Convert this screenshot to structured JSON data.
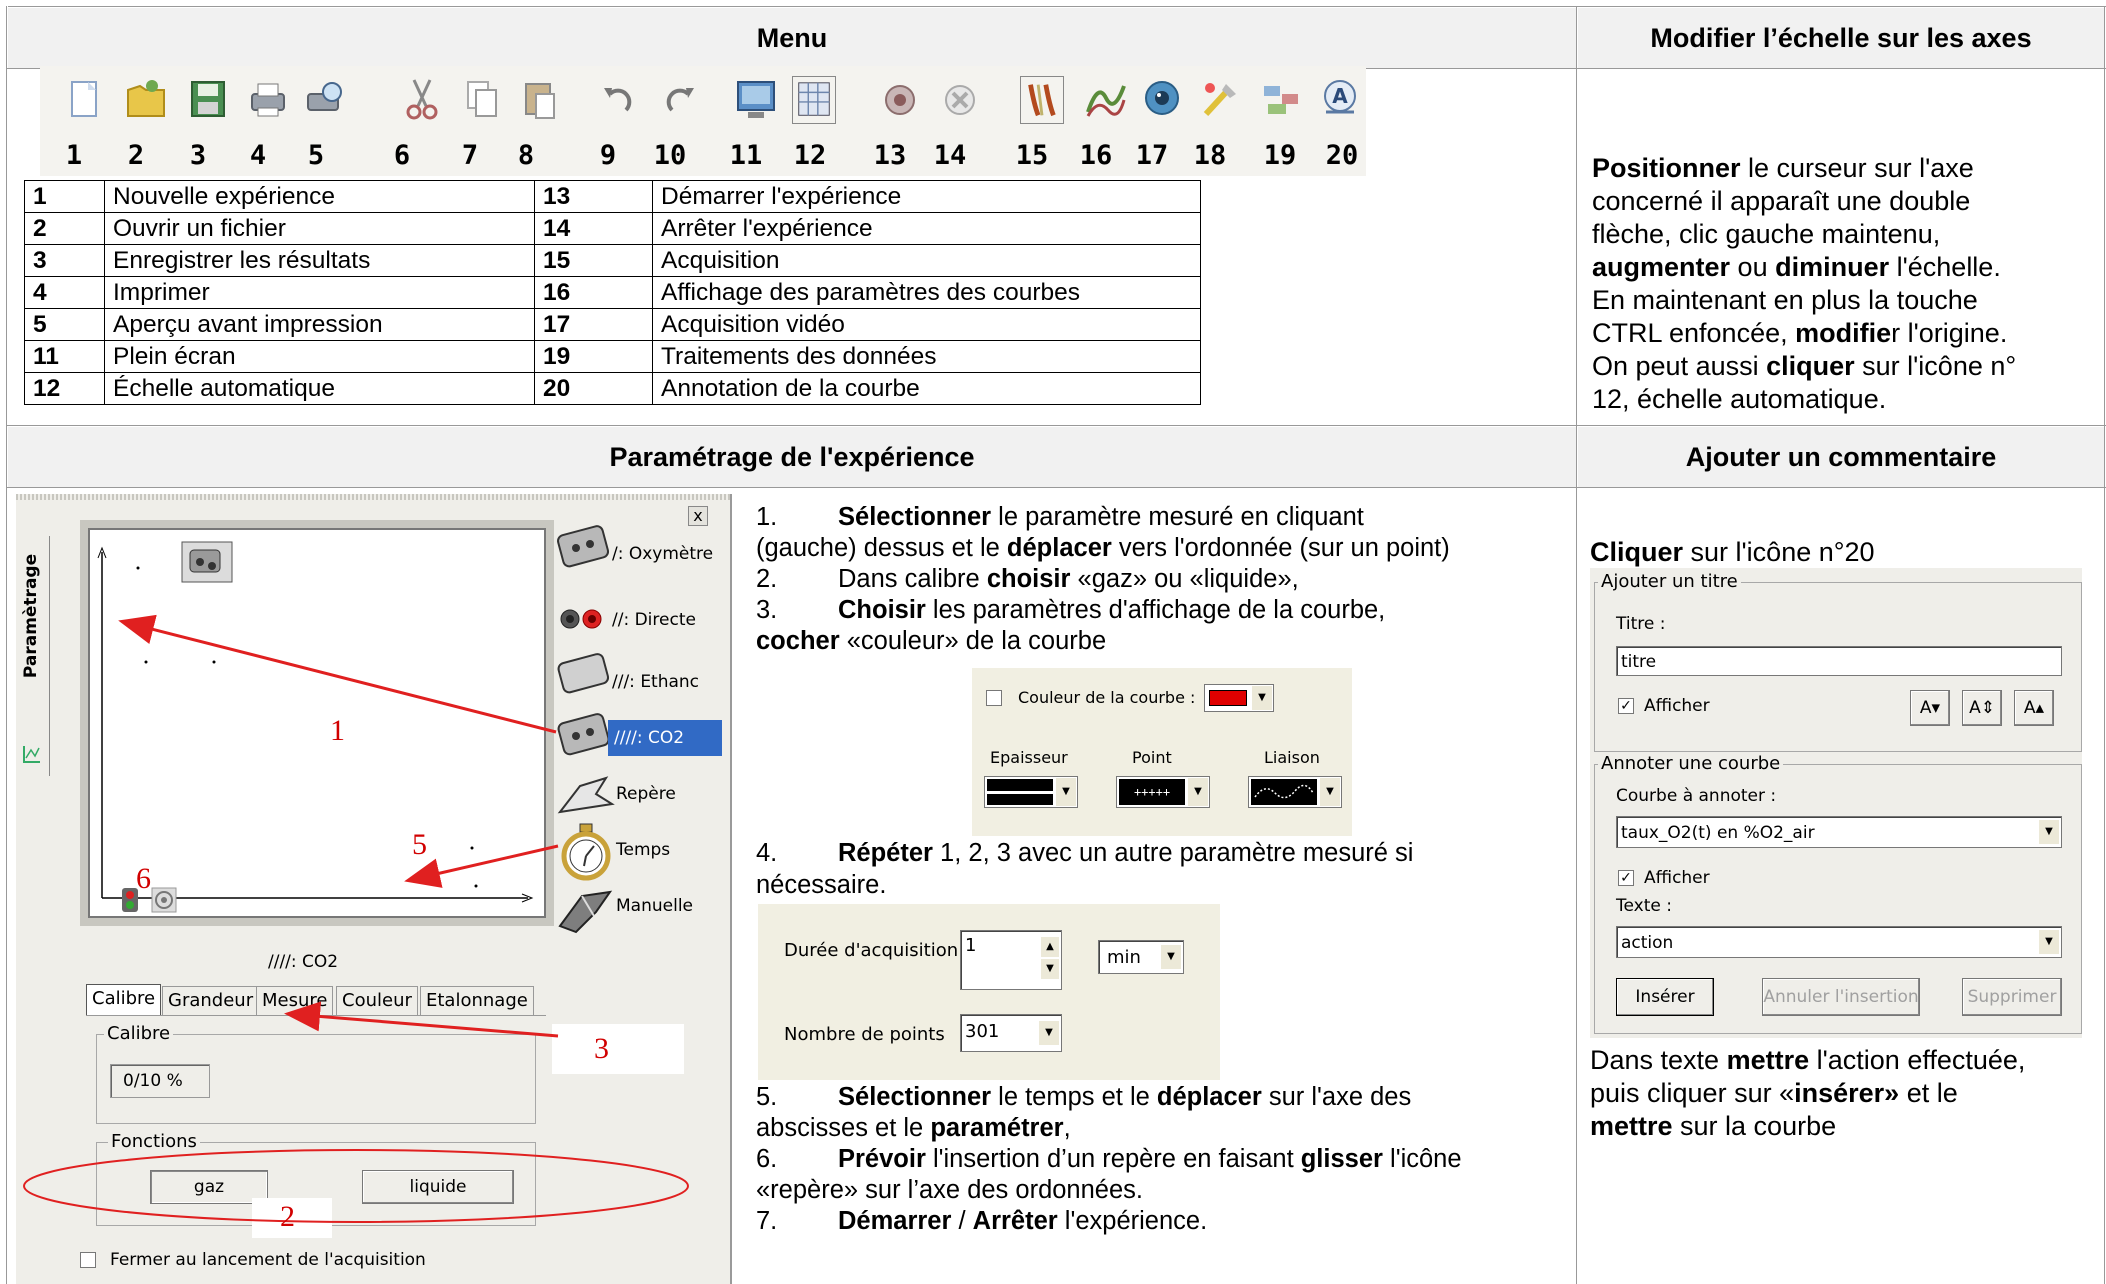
{
  "headers": {
    "menu": "Menu",
    "scale": "Modifier l’échelle sur les axes",
    "setup": "Paramétrage de l'expérience",
    "comment": "Ajouter un commentaire"
  },
  "toolbar": {
    "numbers": [
      "1",
      "2",
      "3",
      "4",
      "5",
      "6",
      "7",
      "8",
      "9",
      "10",
      "11",
      "12",
      "13",
      "14",
      "15",
      "16",
      "17",
      "18",
      "19",
      "20"
    ],
    "icons": [
      "new-file-icon",
      "open-folder-icon",
      "save-icon",
      "print-icon",
      "print-preview-icon",
      "cut-icon",
      "copy-icon",
      "paste-icon",
      "undo-icon",
      "redo-icon",
      "fullscreen-icon",
      "auto-scale-icon",
      "start-icon",
      "stop-icon",
      "acquisition-icon",
      "curve-params-icon",
      "video-icon",
      "tools-icon",
      "data-processing-icon",
      "annotation-icon"
    ]
  },
  "legend": [
    [
      "1",
      "Nouvelle expérience",
      "13",
      "Démarrer l'expérience"
    ],
    [
      "2",
      "Ouvrir un fichier",
      "14",
      "Arrêter l'expérience"
    ],
    [
      "3",
      "Enregistrer les résultats",
      "15",
      "Acquisition"
    ],
    [
      "4",
      "Imprimer",
      "16",
      "Affichage des paramètres des courbes"
    ],
    [
      "5",
      "Aperçu avant impression",
      "17",
      "Acquisition vidéo"
    ],
    [
      "11",
      "Plein écran",
      "19",
      "Traitements des données"
    ],
    [
      "12",
      "Échelle automatique",
      "20",
      "Annotation de la courbe"
    ]
  ],
  "scale_text": [
    [
      [
        "b",
        "Positionner"
      ],
      [
        "t",
        " le curseur sur l'axe"
      ]
    ],
    [
      [
        "t",
        "concerné il apparaît une double"
      ]
    ],
    [
      [
        "t",
        "flèche, clic gauche maintenu,"
      ]
    ],
    [
      [
        "b",
        "augmenter"
      ],
      [
        "t",
        " ou "
      ],
      [
        "b",
        "diminuer"
      ],
      [
        "t",
        " l'échelle."
      ]
    ],
    [
      [
        "t",
        "En maintenant en plus la touche"
      ]
    ],
    [
      [
        "t",
        "CTRL enfoncée, "
      ],
      [
        "b",
        "modifie"
      ],
      [
        "t",
        "r l'origine."
      ]
    ],
    [
      [
        "t",
        "On peut aussi "
      ],
      [
        "b",
        "cliquer"
      ],
      [
        "t",
        " sur l'icône n°"
      ]
    ],
    [
      [
        "t",
        "12, échelle automatique."
      ]
    ]
  ],
  "panel": {
    "vertical_tab": "Paramètrage",
    "close": "x",
    "sensors": [
      "/: Oxymètre",
      "//: Directe",
      "///: Ethanc",
      "////: CO2",
      "Repère",
      "Temps",
      "Manuelle"
    ],
    "graph_label": "////: CO2",
    "tabs": [
      "Calibre",
      "Grandeur",
      "Mesure",
      "Couleur",
      "Etalonnage"
    ],
    "calibre_group": "Calibre",
    "calibre_value": "0/10 %",
    "fonctions_group": "Fonctions",
    "btn_gaz": "gaz",
    "btn_liquide": "liquide",
    "close_checkbox": "Fermer au lancement de l'acquisition"
  },
  "annotations": {
    "n1": "1",
    "n2": "2",
    "n3": "3",
    "n5": "5",
    "n6": "6"
  },
  "steps": {
    "s1_num": "1.",
    "s1": [
      [
        "b",
        "Sélectionner"
      ],
      [
        "t",
        " le paramètre mesuré en cliquant"
      ]
    ],
    "s1b": [
      [
        "t",
        "(gauche) dessus et le "
      ],
      [
        "b",
        "déplacer"
      ],
      [
        "t",
        " vers l'ordonnée (sur un point)"
      ]
    ],
    "s2_num": "2.",
    "s2": [
      [
        "t",
        "Dans calibre "
      ],
      [
        "b",
        "choisir"
      ],
      [
        "t",
        " «gaz» ou «liquide»,"
      ]
    ],
    "s3_num": "3.",
    "s3": [
      [
        "b",
        "Choisir"
      ],
      [
        "t",
        " les paramètres d'affichage de la courbe,"
      ]
    ],
    "s3b": [
      [
        "b",
        "cocher"
      ],
      [
        "t",
        " «couleur» de la courbe"
      ]
    ],
    "s4_num": "4.",
    "s4": [
      [
        "b",
        "Répéter"
      ],
      [
        "t",
        " 1, 2, 3 avec un autre paramètre mesuré si"
      ]
    ],
    "s4b": [
      [
        "t",
        "nécessaire."
      ]
    ],
    "s5_num": "5.",
    "s5": [
      [
        "b",
        "Sélectionner"
      ],
      [
        "t",
        " le temps et le "
      ],
      [
        "b",
        "déplacer"
      ],
      [
        "t",
        " sur l'axe des"
      ]
    ],
    "s5b": [
      [
        "t",
        "abscisses et le "
      ],
      [
        "b",
        "paramétrer"
      ],
      [
        "t",
        ","
      ]
    ],
    "s6_num": "6.",
    "s6": [
      [
        "b",
        "Prévoir"
      ],
      [
        "t",
        " l'insertion d’un repère en faisant "
      ],
      [
        "b",
        "glisser"
      ],
      [
        "t",
        " l'icône"
      ]
    ],
    "s6b": [
      [
        "t",
        "«repère» sur l’axe des ordonnées."
      ]
    ],
    "s7_num": "7.",
    "s7": [
      [
        "b",
        "Démarrer"
      ],
      [
        "t",
        " / "
      ],
      [
        "b",
        "Arrêter"
      ],
      [
        "t",
        " l'expérience."
      ]
    ]
  },
  "curve_widget": {
    "color_label": "Couleur de la courbe :",
    "epaisseur": "Epaisseur",
    "point": "Point",
    "point_value": "+++++",
    "liaison": "Liaison",
    "curve_color": "#e00000"
  },
  "acq_widget": {
    "duration_label": "Durée d'acquisition",
    "duration_value": "1",
    "unit": "min",
    "points_label": "Nombre de points",
    "points_value": "301"
  },
  "comment": {
    "intro": [
      [
        "b",
        "Cliquer"
      ],
      [
        "t",
        " sur l'icône n°20"
      ]
    ],
    "title_group": "Ajouter un titre",
    "titre_label": "Titre :",
    "titre_value": "titre",
    "afficher": "Afficher",
    "font_btns": [
      "A▾",
      "A⇕",
      "A▴"
    ],
    "annot_group": "Annoter une courbe",
    "curve_label": "Courbe à annoter :",
    "curve_value": "taux_O2(t) en %O2_air",
    "afficher2": "Afficher",
    "texte_label": "Texte :",
    "texte_value": "action",
    "btn_insert": "Insérer",
    "btn_cancel": "Annuler l'insertion",
    "btn_delete": "Supprimer",
    "after": [
      [
        [
          "t",
          "Dans texte "
        ],
        [
          "b",
          "mettre"
        ],
        [
          "t",
          " l'action effectuée,"
        ]
      ],
      [
        [
          "t",
          "puis cliquer sur «"
        ],
        [
          "b",
          "insérer»"
        ],
        [
          "t",
          " et le"
        ]
      ],
      [
        [
          "b",
          "mettre"
        ],
        [
          "t",
          "  sur la courbe"
        ]
      ]
    ]
  }
}
